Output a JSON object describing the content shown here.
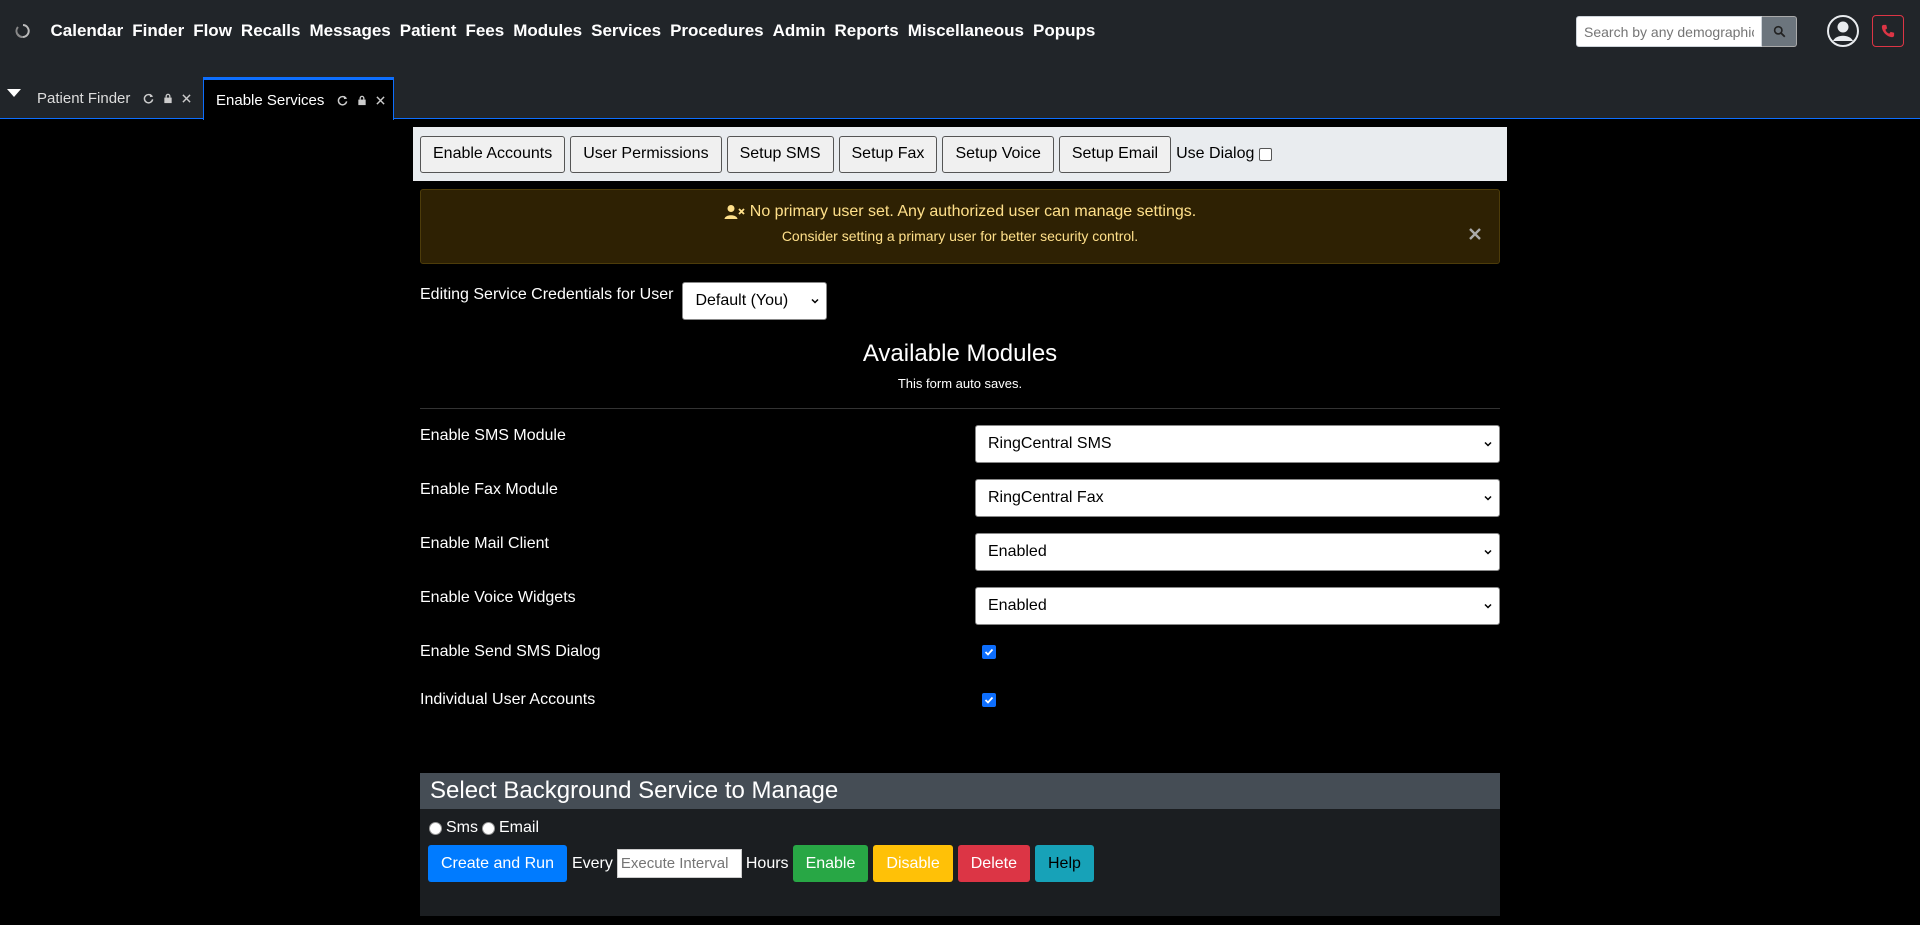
{
  "nav": {
    "items": [
      "Calendar",
      "Finder",
      "Flow",
      "Recalls",
      "Messages",
      "Patient",
      "Fees",
      "Modules",
      "Services",
      "Procedures",
      "Admin",
      "Reports",
      "Miscellaneous",
      "Popups"
    ],
    "search_placeholder": "Search by any demographics"
  },
  "tabs": [
    {
      "label": "Patient Finder",
      "active": false
    },
    {
      "label": "Enable Services",
      "active": true
    }
  ],
  "toolbar": {
    "buttons": [
      "Enable Accounts",
      "User Permissions",
      "Setup SMS",
      "Setup Fax",
      "Setup Voice",
      "Setup Email"
    ],
    "use_dialog_label": "Use Dialog"
  },
  "alert": {
    "main": "No primary user set. Any authorized user can manage settings.",
    "sub": "Consider setting a primary user for better security control."
  },
  "editing": {
    "label": "Editing Service Credentials for User",
    "selected": "Default (You)"
  },
  "modules": {
    "title": "Available Modules",
    "subtitle": "This form auto saves.",
    "rows": [
      {
        "label": "Enable SMS Module",
        "value": "RingCentral SMS"
      },
      {
        "label": "Enable Fax Module",
        "value": "RingCentral Fax"
      },
      {
        "label": "Enable Mail Client",
        "value": "Enabled"
      },
      {
        "label": "Enable Voice Widgets",
        "value": "Enabled"
      },
      {
        "label": "Enable Send SMS Dialog",
        "checked": true
      },
      {
        "label": "Individual User Accounts",
        "checked": true
      }
    ]
  },
  "background": {
    "title": "Select Background Service to Manage",
    "radio_sms": "Sms",
    "radio_email": "Email",
    "create_label": "Create and Run",
    "every_label": "Every",
    "interval_placeholder": "Execute Interval",
    "hours_label": "Hours",
    "enable_label": "Enable",
    "disable_label": "Disable",
    "delete_label": "Delete",
    "help_label": "Help"
  },
  "colors": {
    "primary": "#007bff",
    "success": "#28a745",
    "warning": "#ffc107",
    "danger": "#dc3545",
    "info": "#17a2b8",
    "alert_bg": "#2e2103",
    "alert_text": "#ffe08a"
  }
}
